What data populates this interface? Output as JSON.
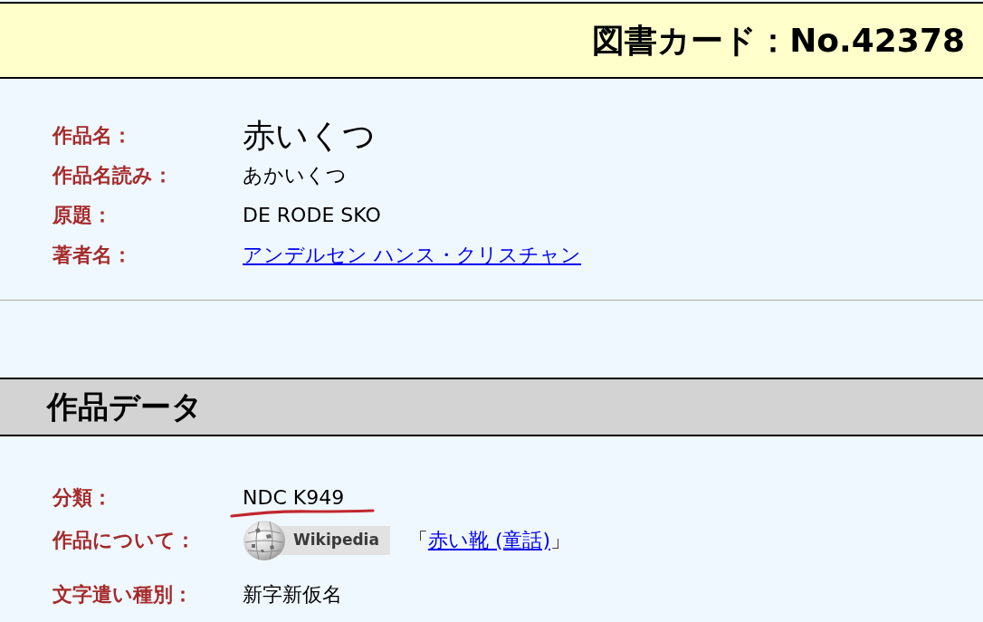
{
  "header": {
    "title": "図書カード：No.42378"
  },
  "work": {
    "fields": [
      {
        "kind": "title",
        "label": "作品名：",
        "value": "赤いくつ"
      },
      {
        "kind": "text",
        "label": "作品名読み：",
        "value": "あかいくつ"
      },
      {
        "kind": "text",
        "label": "原題：",
        "value": "DE RODE SKO"
      },
      {
        "kind": "link",
        "label": "著者名：",
        "value": "アンデルセン ハンス・クリスチャン"
      }
    ]
  },
  "work_data": {
    "heading": "作品データ",
    "fields": [
      {
        "kind": "text",
        "label": "分類：",
        "value": "NDC K949",
        "underlined": true
      },
      {
        "kind": "wiki",
        "label": "作品について：",
        "badge": "Wikipedia",
        "reference": {
          "before": "「",
          "link": "赤い靴 (童話)",
          "after": "」"
        },
        "underlined": false
      },
      {
        "kind": "text",
        "label": "文字遣い種別：",
        "value": "新字新仮名",
        "underlined": false
      }
    ]
  }
}
